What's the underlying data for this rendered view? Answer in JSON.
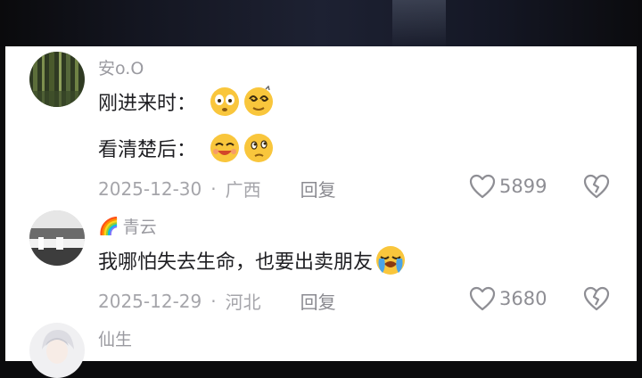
{
  "comments": [
    {
      "username": "安o.O",
      "lines": [
        "刚进来时：",
        "看清楚后："
      ],
      "emojis": [
        "eyes-emoji",
        "dizzy-emoji",
        "smile-emoji",
        "thinking-emoji"
      ],
      "date": "2025-12-30",
      "location": "广西",
      "reply_label": "回复",
      "like_count": "5899"
    },
    {
      "username": "青云",
      "username_icon": "rainbow-icon",
      "lines": [
        "我哪怕失去生命，也要出卖朋友"
      ],
      "emojis": [
        "crying-emoji"
      ],
      "date": "2025-12-29",
      "location": "河北",
      "reply_label": "回复",
      "like_count": "3680"
    },
    {
      "username": "仙生"
    }
  ],
  "separator": "·",
  "colors": {
    "meta_text": "#a5a5aa",
    "body_text": "#1e1e22",
    "background": "#ffffff"
  }
}
